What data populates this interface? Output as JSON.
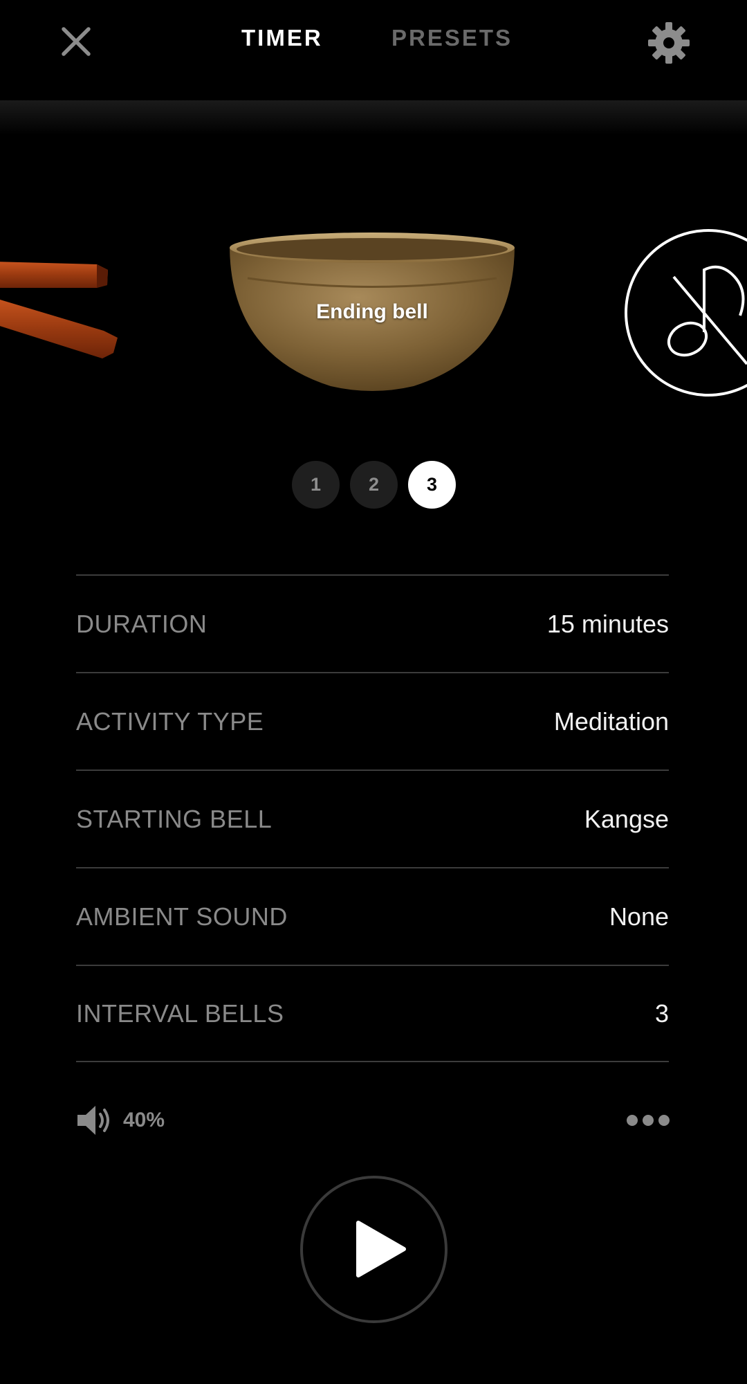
{
  "header": {
    "tabs": [
      {
        "label": "TIMER",
        "active": true
      },
      {
        "label": "PRESETS",
        "active": false
      }
    ],
    "close_icon": "close-icon",
    "settings_icon": "gear-icon"
  },
  "carousel": {
    "items": [
      {
        "name": "wooden-clappers",
        "icon": "clapper-sticks-icon"
      },
      {
        "name": "singing-bowl",
        "label": "Ending bell"
      },
      {
        "name": "no-sound",
        "icon": "no-music-icon"
      }
    ]
  },
  "pager": {
    "pages": [
      "1",
      "2",
      "3"
    ],
    "active": "3"
  },
  "settings": [
    {
      "label": "DURATION",
      "value": "15 minutes"
    },
    {
      "label": "ACTIVITY TYPE",
      "value": "Meditation"
    },
    {
      "label": "STARTING BELL",
      "value": "Kangse"
    },
    {
      "label": "AMBIENT SOUND",
      "value": "None"
    },
    {
      "label": "INTERVAL BELLS",
      "value": "3"
    }
  ],
  "volume": {
    "label": "40%",
    "level": 0.4,
    "icon": "speaker-icon"
  },
  "more_icon": "more-dots-icon",
  "play_icon": "play-icon",
  "colors": {
    "background": "#000000",
    "accent": "#ffffff",
    "muted": "#8a8a8a",
    "divider": "#3c3c3c"
  }
}
